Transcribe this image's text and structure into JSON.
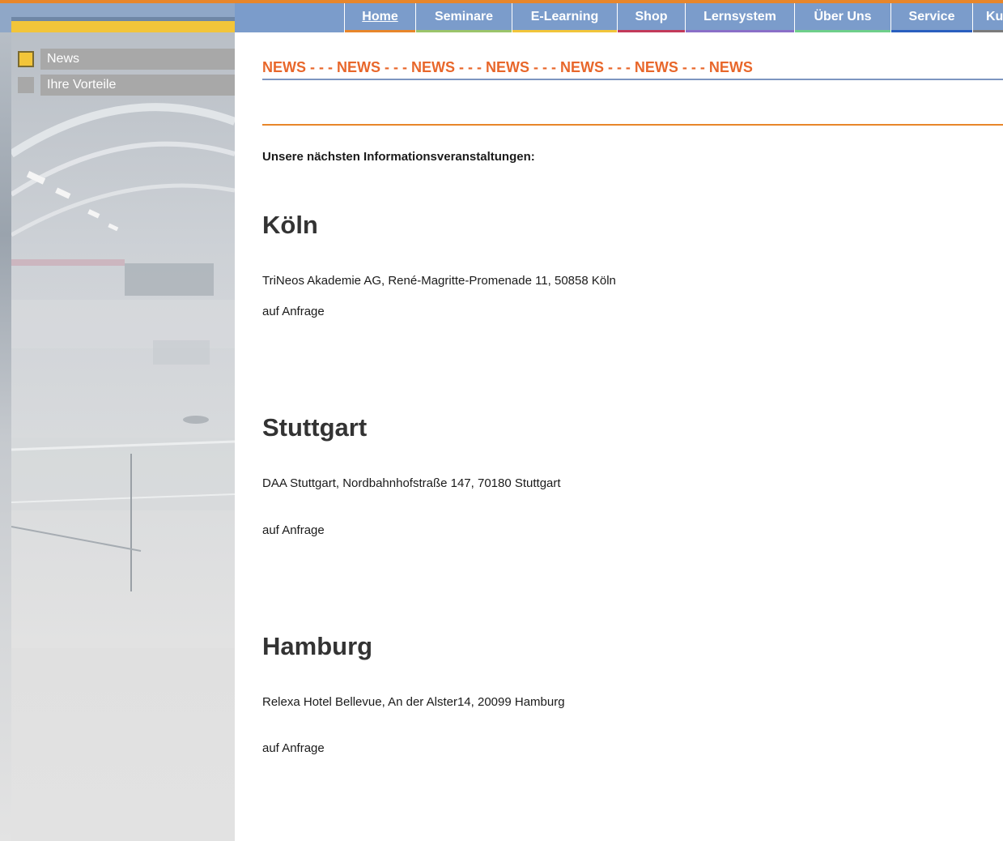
{
  "nav": {
    "items": [
      {
        "label": "Home",
        "active": true,
        "accent": "#e8862a"
      },
      {
        "label": "Seminare",
        "active": false,
        "accent": "#9bc46a"
      },
      {
        "label": "E-Learning",
        "active": false,
        "accent": "#f2c53a"
      },
      {
        "label": "Shop",
        "active": false,
        "accent": "#c23a5a"
      },
      {
        "label": "Lernsystem",
        "active": false,
        "accent": "#8a6fc7"
      },
      {
        "label": "Über Uns",
        "active": false,
        "accent": "#6fcf8a"
      },
      {
        "label": "Service",
        "active": false,
        "accent": "#2a5fbf"
      },
      {
        "label": "Ku",
        "active": false,
        "accent": "#7b7b7b"
      }
    ]
  },
  "sidebar": {
    "items": [
      {
        "label": "News",
        "square_color": "#f2c53a"
      },
      {
        "label": "Ihre Vorteile",
        "square_color": "#a8a8a8"
      }
    ]
  },
  "main": {
    "ticker": "NEWS - - - NEWS - - - NEWS - - - NEWS - - - NEWS - - - NEWS - - - NEWS",
    "intro": "Unsere nächsten Informationsveranstaltungen:",
    "events": [
      {
        "city": "Köln",
        "address": "TriNeos Akademie AG, René-Magritte-Promenade 11, 50858 Köln",
        "date": "auf Anfrage"
      },
      {
        "city": "Stuttgart",
        "address": "DAA Stuttgart, Nordbahnhofstraße 147, 70180 Stuttgart",
        "date": "auf Anfrage"
      },
      {
        "city": "Hamburg",
        "address": "Relexa Hotel Bellevue, An der Alster14, 20099 Hamburg",
        "date": "auf Anfrage"
      }
    ]
  },
  "colors": {
    "accent_orange": "#e8672b",
    "nav_blue": "#7b9ccb",
    "sidebar_yellow": "#f2c53a"
  }
}
